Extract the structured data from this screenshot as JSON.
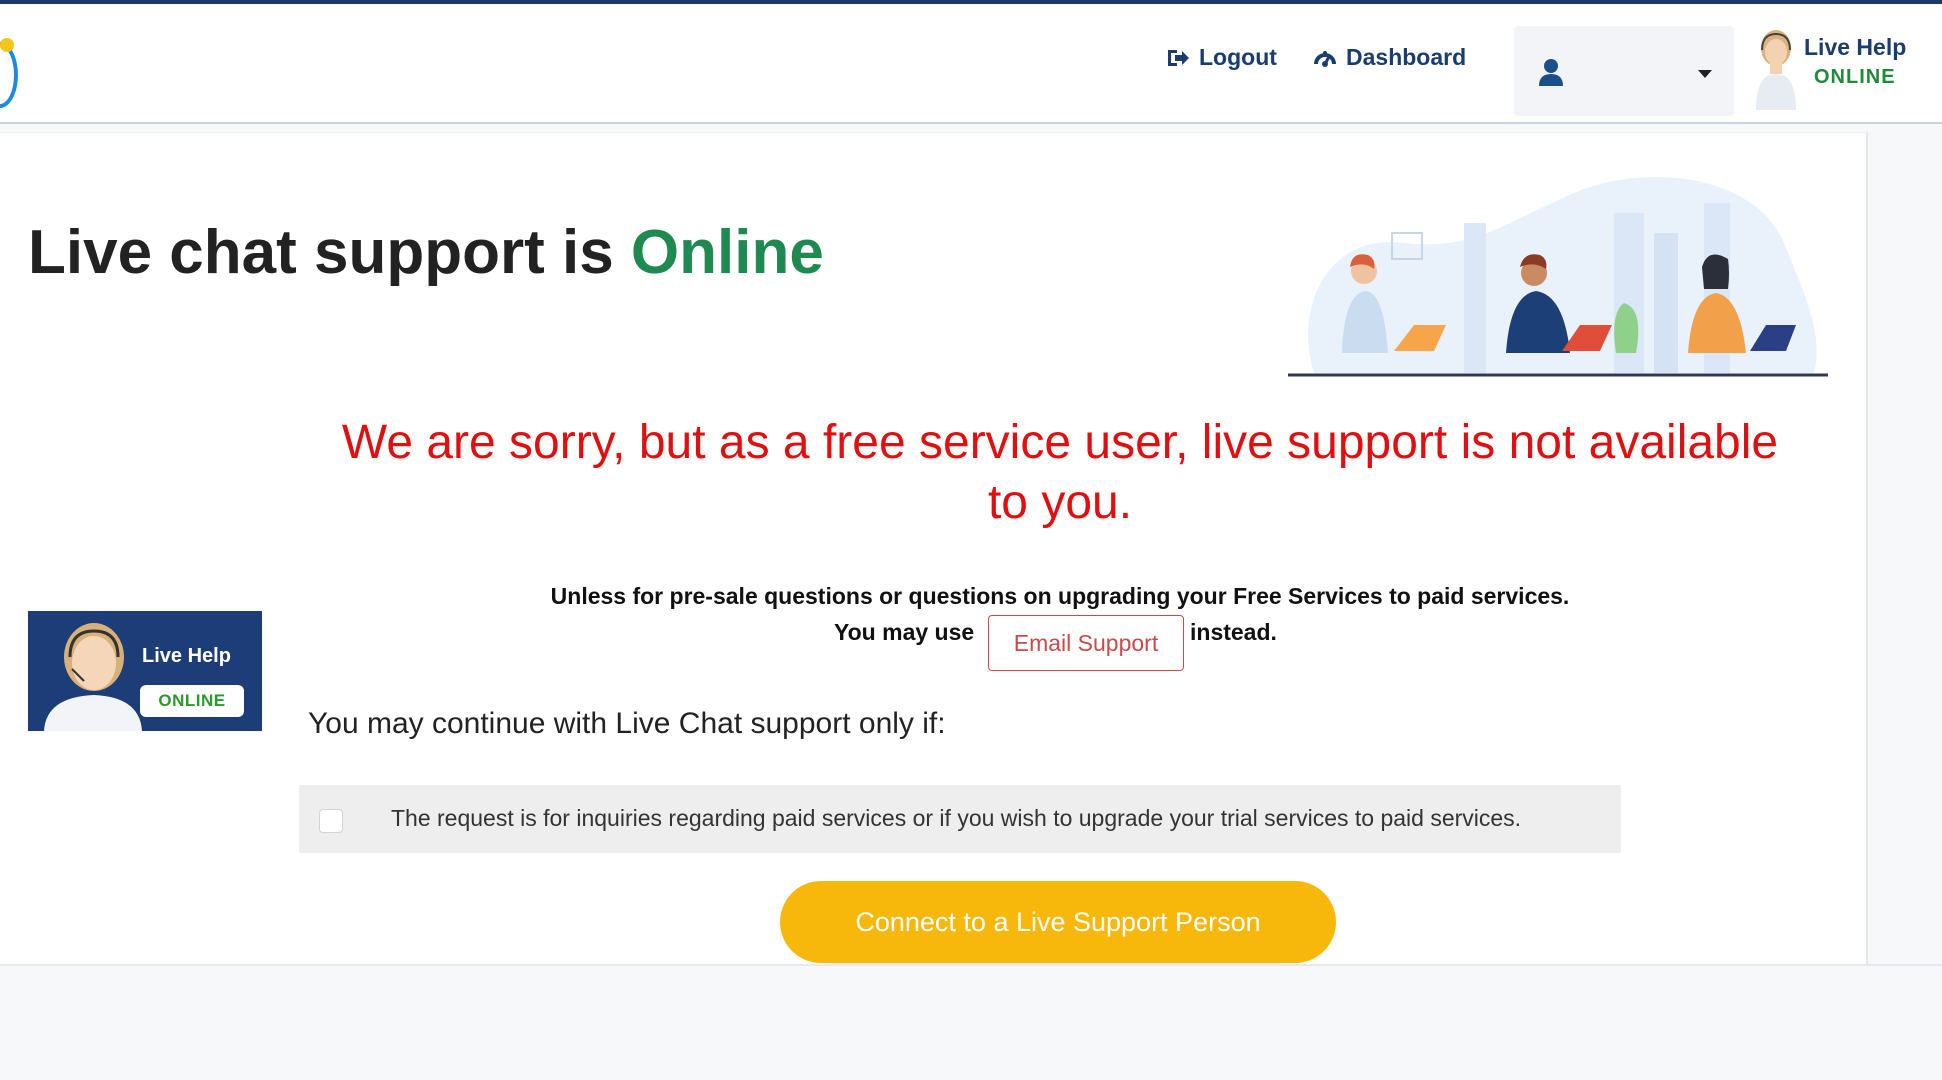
{
  "navbar": {
    "logout_label": "Logout",
    "dashboard_label": "Dashboard",
    "user_name": "",
    "live_help": {
      "line1": "Live Help",
      "line2": "ONLINE"
    }
  },
  "main": {
    "title_prefix": "Live chat support is ",
    "title_status": "Online",
    "sorry_message": "We are sorry, but as a free service user, live support is not available to you.",
    "note_line1": "Unless for pre-sale questions or questions on upgrading your Free Services to paid services.",
    "note_line2_prefix": "You may use",
    "email_support_label": "Email Support",
    "note_line2_suffix": "instead.",
    "continue_label": "You may continue with Live Chat support only if:",
    "condition_text": "The request is for inquiries regarding paid services or if you wish to upgrade your trial services to paid services.",
    "condition_checked": false,
    "connect_button_label": "Connect to a Live Support Person"
  },
  "badge": {
    "label": "Live Help",
    "status": "ONLINE"
  },
  "colors": {
    "nav_text": "#1b3c6e",
    "online_green": "#1f8a4f",
    "error_red": "#e01010",
    "email_border": "#c94a4a",
    "connect_yellow": "#f7b80b",
    "badge_bg": "#1c3d78"
  },
  "icons": {
    "logout": "sign-out-icon",
    "dashboard": "tachometer-icon",
    "user": "user-icon",
    "caret": "caret-down-icon"
  }
}
